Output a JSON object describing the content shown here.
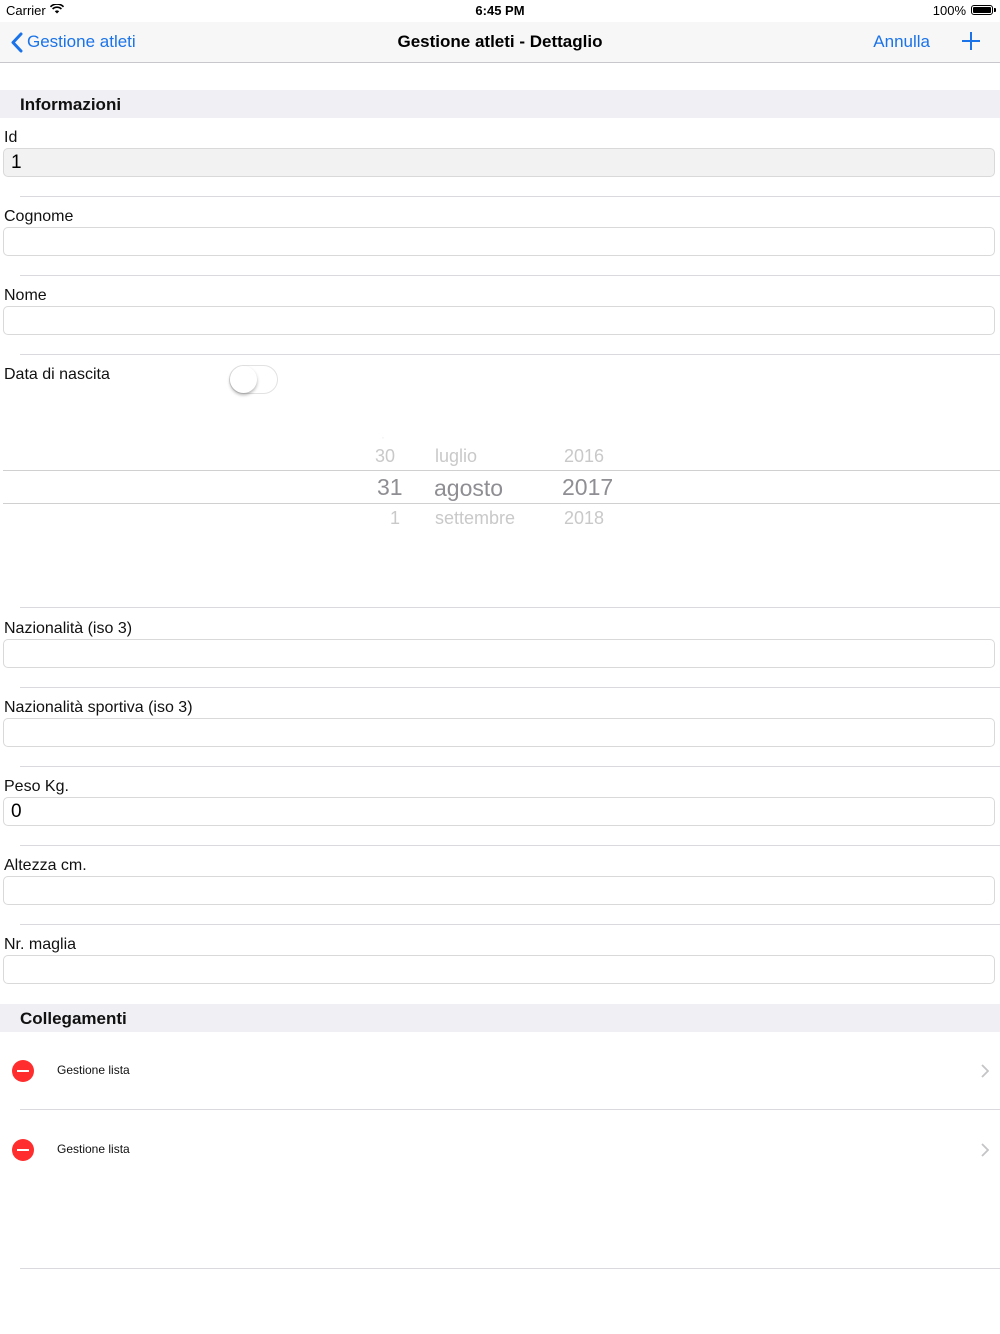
{
  "status_bar": {
    "carrier": "Carrier",
    "time": "6:45 PM",
    "battery": "100%"
  },
  "nav": {
    "back_label": "Gestione atleti",
    "title": "Gestione atleti - Dettaglio",
    "cancel_label": "Annulla",
    "add_icon": "plus-icon"
  },
  "sections": {
    "info": "Informazioni",
    "links": "Collegamenti"
  },
  "fields": {
    "id": {
      "label": "Id",
      "value": "1"
    },
    "cognome": {
      "label": "Cognome",
      "value": ""
    },
    "nome": {
      "label": "Nome",
      "value": ""
    },
    "data_nascita": {
      "label": "Data di nascita",
      "enabled": false
    },
    "nazionalita": {
      "label": "Nazionalità (iso 3)",
      "value": ""
    },
    "nazionalita_sportiva": {
      "label": "Nazionalità sportiva (iso 3)",
      "value": ""
    },
    "peso": {
      "label": "Peso Kg.",
      "value": "0"
    },
    "altezza": {
      "label": "Altezza cm.",
      "value": ""
    },
    "maglia": {
      "label": "Nr. maglia",
      "value": ""
    }
  },
  "date_picker": {
    "day": {
      "prev": "30",
      "selected": "31",
      "next": "1"
    },
    "month": {
      "prev": "luglio",
      "selected": "agosto",
      "next": "settembre"
    },
    "year": {
      "prev": "2016",
      "selected": "2017",
      "next": "2018"
    }
  },
  "links": [
    {
      "label": "Gestione lista"
    },
    {
      "label": "Gestione lista"
    }
  ],
  "colors": {
    "accent": "#1a73e8",
    "delete": "#ff2d2d",
    "section_bg": "#efeff4"
  }
}
